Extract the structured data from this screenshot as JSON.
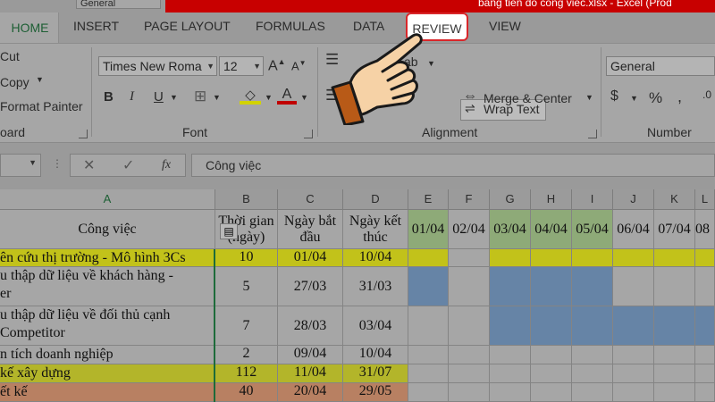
{
  "window": {
    "doc_title": "bang tien do cong viec.xlsx - Excel (Prod"
  },
  "top_format_box": "General",
  "tabs": [
    {
      "label": "HOME"
    },
    {
      "label": "INSERT"
    },
    {
      "label": "PAGE LAYOUT"
    },
    {
      "label": "FORMULAS"
    },
    {
      "label": "DATA"
    },
    {
      "label": "REVIEW"
    },
    {
      "label": "VIEW"
    }
  ],
  "clipboard": {
    "cut": "Cut",
    "copy": "Copy",
    "format_painter": "Format Painter",
    "group": "oard"
  },
  "font": {
    "name": "Times New Roma",
    "size": "12",
    "group": "Font",
    "bold": "B",
    "italic": "I",
    "underline": "U"
  },
  "alignment": {
    "wrap": "Wrap Text",
    "merge": "Merge & Center",
    "group": "Alignment"
  },
  "number": {
    "format": "General",
    "group": "Number",
    "percent": "%"
  },
  "formula_bar": {
    "fx": "fx",
    "value": "Công việc"
  },
  "columns": [
    "A",
    "B",
    "C",
    "D",
    "E",
    "F",
    "G",
    "H",
    "I",
    "J",
    "K",
    "L"
  ],
  "header_row": {
    "task": "Công việc",
    "duration": "Thời gian (ngày)",
    "start": "Ngày bắt đầu",
    "end": "Ngày kết thúc",
    "dates": [
      "01/04",
      "02/04",
      "03/04",
      "04/04",
      "05/04",
      "06/04",
      "07/04",
      "08"
    ]
  },
  "rows": [
    {
      "task": "ên cứu thị trường - Mô hình 3Cs",
      "task2": "",
      "duration": "10",
      "start": "01/04",
      "end": "10/04"
    },
    {
      "task": "u thập dữ liệu về khách hàng -",
      "task2": "er",
      "duration": "5",
      "start": "27/03",
      "end": "31/03"
    },
    {
      "task": "u thập dữ liệu về đối thủ cạnh",
      "task2": "Competitor",
      "duration": "7",
      "start": "28/03",
      "end": "03/04"
    },
    {
      "task": "n tích doanh nghiệp",
      "task2": "",
      "duration": "2",
      "start": "09/04",
      "end": "10/04"
    },
    {
      "task": "kế xây dựng",
      "task2": "",
      "duration": "112",
      "start": "11/04",
      "end": "31/07"
    },
    {
      "task": "ết kế",
      "task2": "",
      "duration": "40",
      "start": "20/04",
      "end": "29/05"
    }
  ],
  "colors": {
    "highlight_yellow": "#c2c21a",
    "bar_blue": "#6684a6",
    "date_header_green": "#8eaa78",
    "review_outline": "#d9262a"
  }
}
